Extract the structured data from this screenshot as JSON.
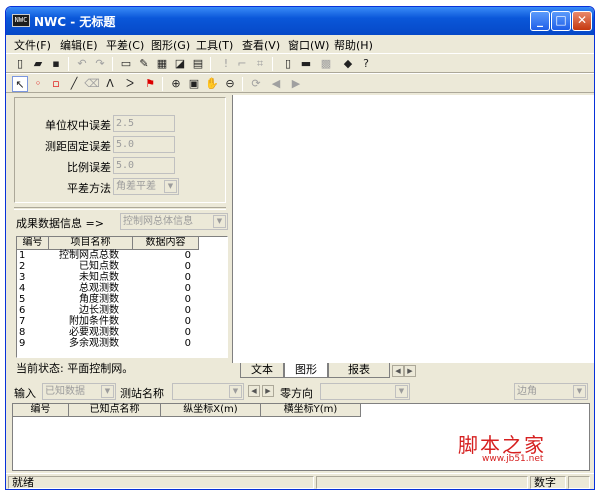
{
  "window": {
    "app_badge": "NWC",
    "title": "NWC - 无标题",
    "minimize": "_",
    "maximize": "□",
    "close": "✕"
  },
  "menu": [
    "文件(F)",
    "编辑(E)",
    "平差(C)",
    "图形(G)",
    "工具(T)",
    "查看(V)",
    "窗口(W)",
    "帮助(H)"
  ],
  "params": {
    "unit_weight_label": "单位权中误差",
    "unit_weight_value": "2.5",
    "fixed_error_label": "测距固定误差",
    "fixed_error_value": "5.0",
    "ratio_error_label": "比例误差",
    "ratio_error_value": "5.0",
    "method_label": "平差方法",
    "method_value": "角差平差"
  },
  "result": {
    "label": "成果数据信息 =>",
    "selected": "控制网总体信息"
  },
  "info_table": {
    "headers": [
      "编号",
      "项目名称",
      "数据内容"
    ],
    "rows": [
      {
        "id": "1",
        "name": "控制网点总数",
        "value": "0"
      },
      {
        "id": "2",
        "name": "已知点数",
        "value": "0"
      },
      {
        "id": "3",
        "name": "未知点数",
        "value": "0"
      },
      {
        "id": "4",
        "name": "总观测数",
        "value": "0"
      },
      {
        "id": "5",
        "name": "角度测数",
        "value": "0"
      },
      {
        "id": "6",
        "name": "边长测数",
        "value": "0"
      },
      {
        "id": "7",
        "name": "附加条件数",
        "value": "0"
      },
      {
        "id": "8",
        "name": "必要观测数",
        "value": "0"
      },
      {
        "id": "9",
        "name": "多余观测数",
        "value": "0"
      }
    ]
  },
  "current_state": "当前状态: 平面控制网。",
  "tabs": [
    "文本",
    "图形",
    "报表"
  ],
  "input_bar": {
    "input_label": "输入",
    "input_value": "已知数据",
    "station_label": "测站名称",
    "zero_dir_label": "零方向",
    "side_value": "边角"
  },
  "known_table": {
    "headers": [
      "编号",
      "已知点名称",
      "纵坐标X(m)",
      "横坐标Y(m)"
    ]
  },
  "status": {
    "ready": "就绪",
    "numlock": "数字"
  },
  "watermark": {
    "text": "脚本之家",
    "url": "www.jb51.net"
  }
}
